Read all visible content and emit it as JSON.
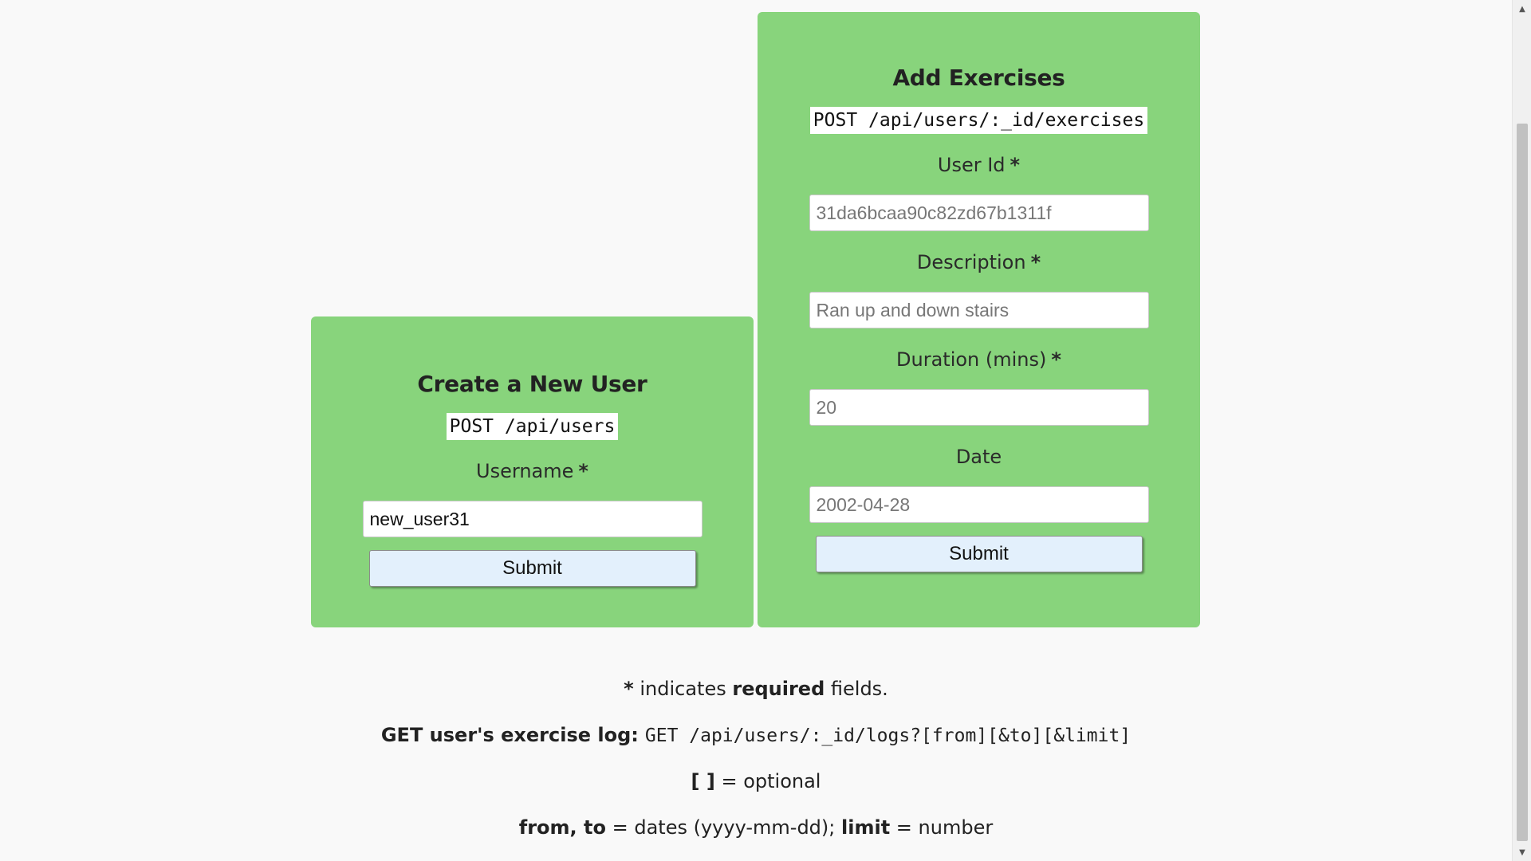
{
  "create_user": {
    "title": "Create a New User",
    "endpoint": "POST /api/users",
    "username_label": "Username",
    "required_mark": "*",
    "username_value": "new_user31",
    "submit_label": "Submit"
  },
  "add_exercises": {
    "title": "Add Exercises",
    "endpoint": "POST /api/users/:_id/exercises",
    "required_mark": "*",
    "userid_label": "User Id",
    "userid_placeholder": "31da6bcaa90c82zd67b1311f",
    "description_label": "Description",
    "description_placeholder": "Ran up and down stairs",
    "duration_label": "Duration (mins)",
    "duration_placeholder": "20",
    "date_label": "Date",
    "date_placeholder": "2002-04-28",
    "submit_label": "Submit"
  },
  "info": {
    "required_star": "*",
    "required_text_1": " indicates ",
    "required_bold": "required",
    "required_text_2": " fields.",
    "get_label": "GET user's exercise log:",
    "get_endpoint": "GET /api/users/:_id/logs?[from][&to][&limit]",
    "optional_bold": "[ ]",
    "optional_text": " = optional",
    "from_bold": "from, to",
    "from_text": " = dates (yyyy-mm-dd); ",
    "limit_bold": "limit",
    "limit_text": " = number"
  },
  "colors": {
    "card_background": "#88d47c",
    "page_background": "#f9f9f9",
    "button_background": "#e3f0fc"
  },
  "icons": {
    "scroll_up": "scroll-up-arrow-icon",
    "scroll_down": "scroll-down-arrow-icon"
  }
}
